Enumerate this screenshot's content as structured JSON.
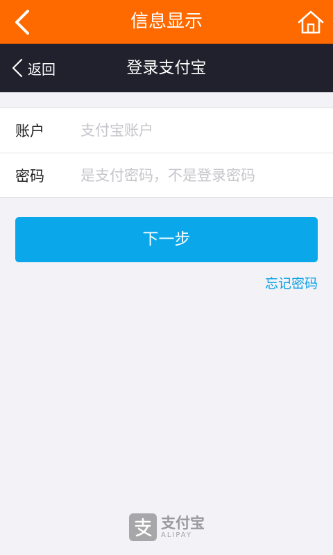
{
  "topbar": {
    "title": "信息显示",
    "back_icon": "chevron-left-icon",
    "home_icon": "home-icon"
  },
  "navbar": {
    "back_label": "返回",
    "title": "登录支付宝"
  },
  "form": {
    "account_label": "账户",
    "account_placeholder": "支付宝账户",
    "account_value": "",
    "password_label": "密码",
    "password_placeholder": "是支付密码，不是登录密码",
    "password_value": ""
  },
  "actions": {
    "next_label": "下一步",
    "forgot_label": "忘记密码"
  },
  "footer": {
    "brand_cn": "支付宝",
    "brand_en": "ALIPAY"
  },
  "colors": {
    "topbar": "#ff6a00",
    "navbar": "#20212d",
    "button": "#0aa8ea",
    "link": "#0aa0e6",
    "background": "#f2f2f7"
  }
}
